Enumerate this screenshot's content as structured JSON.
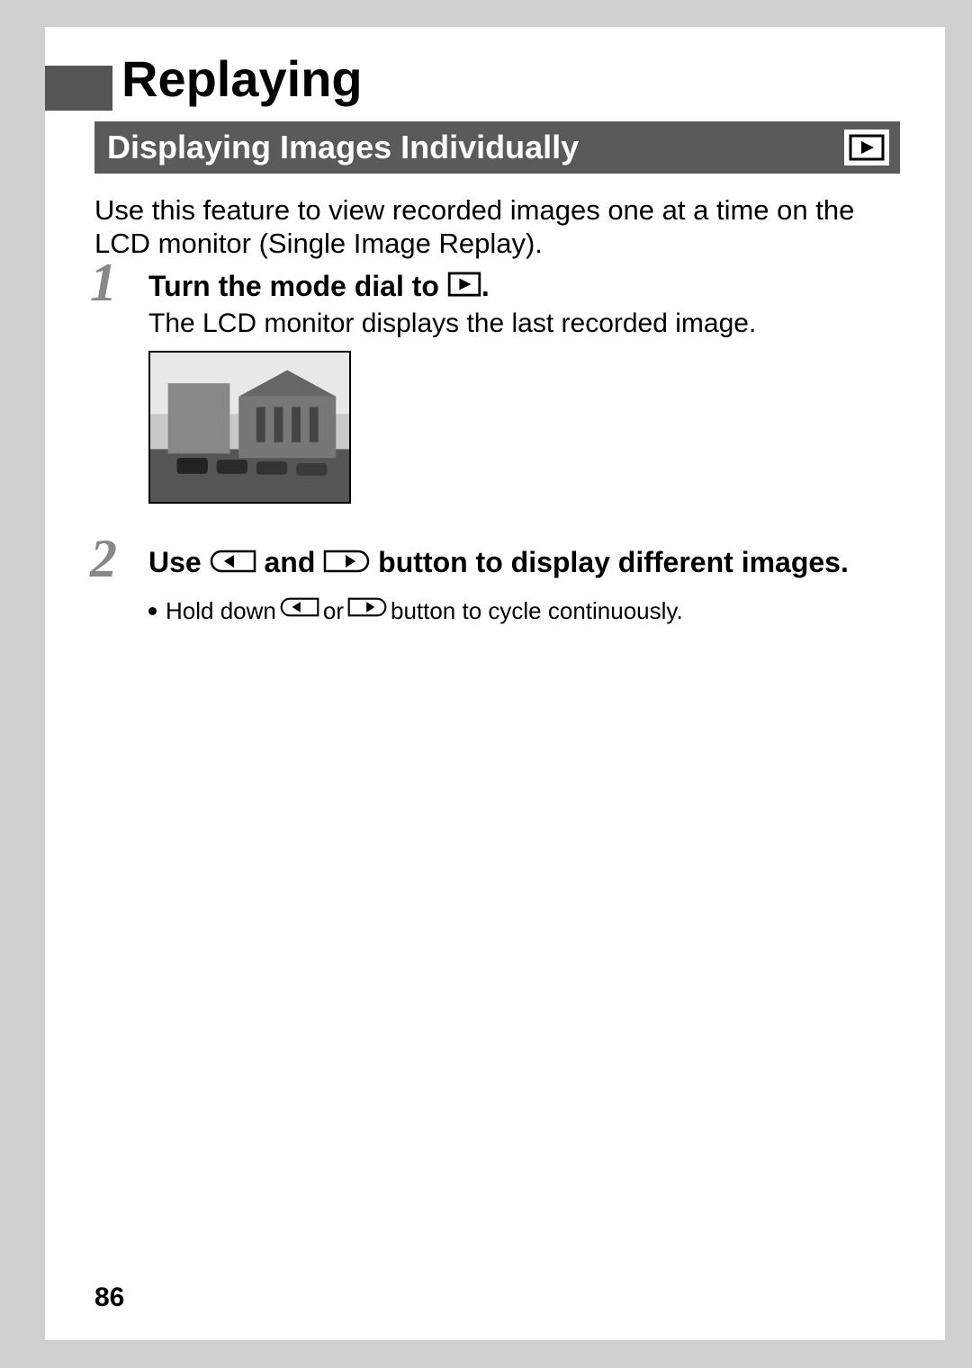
{
  "chapter_title": "Replaying",
  "section_title": "Displaying Images Individually",
  "intro": "Use this feature to view recorded images one at a time on the LCD monitor (Single Image Replay).",
  "steps": [
    {
      "num": "1",
      "heading_a": "Turn the mode dial to ",
      "heading_b": ".",
      "desc": "The LCD monitor displays the last recorded image."
    },
    {
      "num": "2",
      "heading_a": "Use ",
      "heading_b": " and ",
      "heading_c": " button to display different images.",
      "bullet_a": "Hold down ",
      "bullet_b": " or ",
      "bullet_c": " button to cycle continuously."
    }
  ],
  "page_number": "86",
  "icons": {
    "playback": "playback-icon",
    "left": "left-button-icon",
    "right": "right-button-icon"
  }
}
